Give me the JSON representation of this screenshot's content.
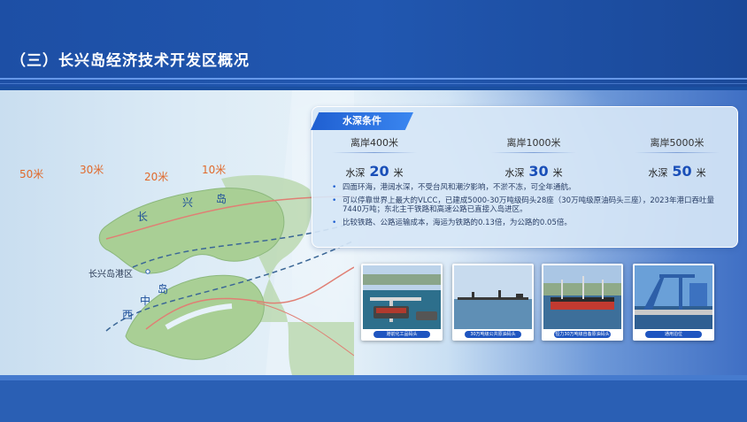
{
  "header": {
    "title": "（三）长兴岛经济技术开发区概况"
  },
  "map": {
    "depth_labels": [
      "50米",
      "30米",
      "20米",
      "10米"
    ],
    "island_name_chars": [
      "长",
      "兴",
      "岛"
    ],
    "xizhong_chars": [
      "西",
      "中",
      "岛"
    ],
    "port_label": "长兴岛港区"
  },
  "panel": {
    "tag": "水深条件",
    "columns": [
      {
        "distance": "离岸400米",
        "depth_prefix": "水深",
        "depth_value": "20",
        "depth_unit": "米"
      },
      {
        "distance": "离岸1000米",
        "depth_prefix": "水深",
        "depth_value": "30",
        "depth_unit": "米"
      },
      {
        "distance": "离岸5000米",
        "depth_prefix": "水深",
        "depth_value": "50",
        "depth_unit": "米"
      }
    ],
    "bullets": [
      "四面环海，港阔水深，不受台风和潮汐影响，不淤不冻，可全年通航。",
      "可以停靠世界上最大的VLCC，已建成5000-30万吨级码头28座（30万吨级原油码头三座），2023年港口吞吐量7440万吨；东北主干铁路和高速公路已直接入岛进区。",
      "比较铁路、公路运输成本，海运为铁路的0.13倍，为公路的0.05倍。"
    ]
  },
  "photos": [
    {
      "caption": "港前化工品码头"
    },
    {
      "caption": "30万吨级公共原油码头"
    },
    {
      "caption": "恒力30万吨级自备原油码头"
    },
    {
      "caption": "通用泊位"
    }
  ],
  "colors": {
    "header": "#1d4fa5",
    "accent": "#1f5fd1",
    "depth_orange": "#e06a2c"
  }
}
